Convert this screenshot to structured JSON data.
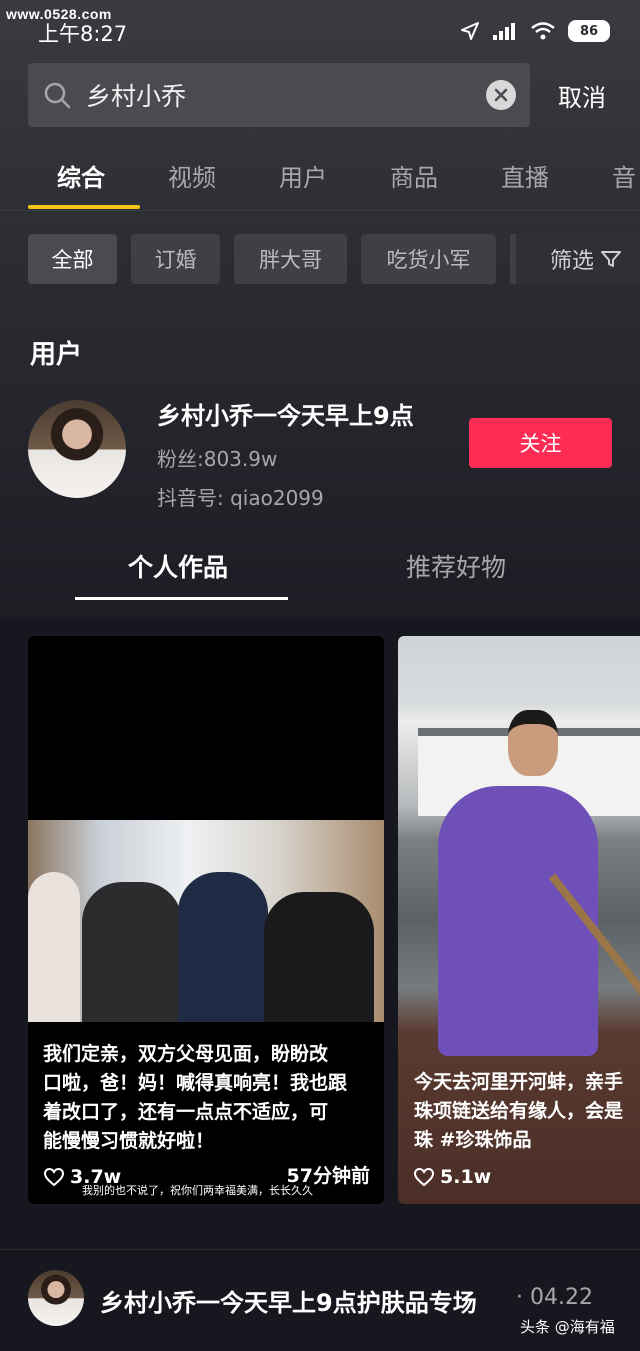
{
  "watermark": "www.0528.com",
  "status_bar": {
    "time": "上午8:27",
    "battery": "86",
    "icons": [
      "location-icon",
      "signal-icon",
      "wifi-icon",
      "battery-icon"
    ]
  },
  "search": {
    "query": "乡村小乔",
    "cancel_label": "取消"
  },
  "tabs": [
    "综合",
    "视频",
    "用户",
    "商品",
    "直播",
    "音"
  ],
  "active_tab": "综合",
  "filters": {
    "chips": [
      "全部",
      "订婚",
      "胖大哥",
      "吃货小军"
    ],
    "filter_label": "筛选"
  },
  "user_section": {
    "title": "用户",
    "name": "乡村小乔一今天早上9点",
    "fans": "粉丝:803.9w",
    "douyin_id": "抖音号: qiao2099",
    "follow_label": "关注"
  },
  "sub_tabs": [
    "个人作品",
    "推荐好物"
  ],
  "videos": [
    {
      "photo_caption": "我别的也不说了，祝你们两幸福美满，长长久久",
      "description_lines": [
        "我们定亲，双方父母见面，盼盼改",
        "口啦，爸！妈！喊得真响亮！我也跟",
        "着改口了，还有一点点不适应，可",
        "能慢慢习惯就好啦！"
      ],
      "likes": "3.7w",
      "time_ago": "57分钟前"
    },
    {
      "description_lines": [
        "今天去河里开河蚌，亲手",
        "珠项链送给有缘人，会是",
        "珠 #珍珠饰品"
      ],
      "likes": "5.1w"
    }
  ],
  "live": {
    "title": "乡村小乔一今天早上9点护肤品专场",
    "date": "· 04.22"
  },
  "source": "头条 @海有福",
  "colors": {
    "accent_tab": "#f5c518",
    "follow": "#fe2c55",
    "background": "#17181f"
  }
}
